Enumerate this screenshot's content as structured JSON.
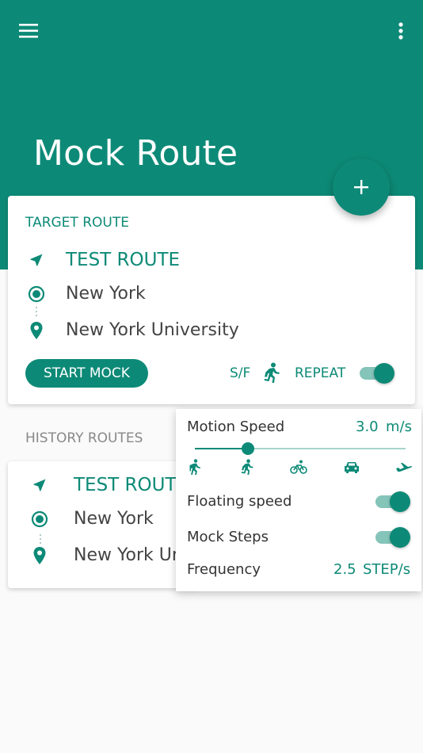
{
  "app": {
    "title": "Mock Route"
  },
  "colors": {
    "accent": "#0d8a77",
    "accent_light": "#84c4b9",
    "background": "#fafafa"
  },
  "toolbar": {
    "menu_icon": "menu-icon",
    "more_icon": "more-vert-icon"
  },
  "fab": {
    "icon": "add-icon"
  },
  "target_route": {
    "section_label": "TARGET ROUTE",
    "name": "TEST ROUTE",
    "origin": "New York",
    "destination": "New York University",
    "start_button": "START MOCK",
    "sf_label": "S/F",
    "repeat_label": "REPEAT",
    "repeat_enabled": true
  },
  "history": {
    "section_label": "HISTORY ROUTES",
    "items": [
      {
        "name": "TEST ROUTE",
        "origin": "New York",
        "destination": "New York University"
      }
    ]
  },
  "speed_panel": {
    "motion_speed_label": "Motion Speed",
    "motion_speed_value": "3.0",
    "motion_speed_unit": "m/s",
    "slider_fraction": 0.25,
    "modes": [
      "walk-icon",
      "run-icon",
      "bike-icon",
      "car-icon",
      "plane-icon"
    ],
    "floating_speed_label": "Floating speed",
    "floating_speed_enabled": true,
    "mock_steps_label": "Mock Steps",
    "mock_steps_enabled": true,
    "frequency_label": "Frequency",
    "frequency_value": "2.5",
    "frequency_unit": "STEP/s"
  }
}
